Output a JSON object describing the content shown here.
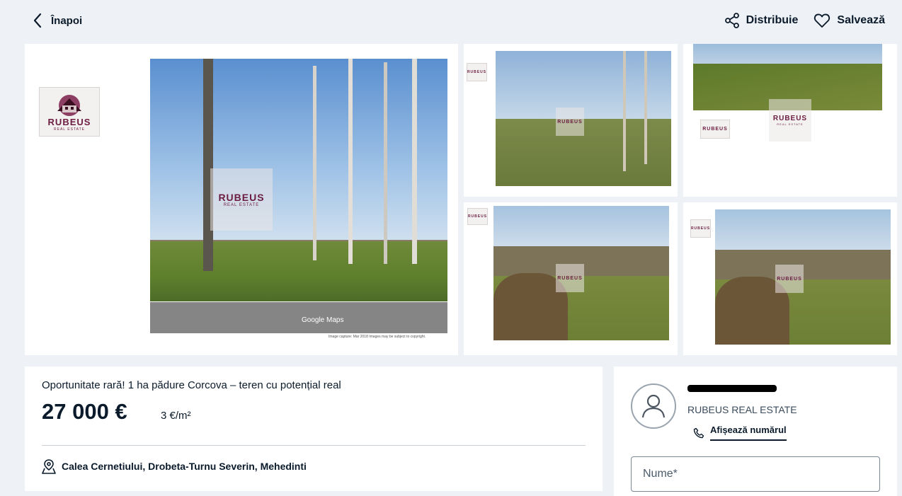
{
  "nav": {
    "back_label": "Înapoi",
    "share_label": "Distribuie",
    "save_label": "Salvează"
  },
  "gallery": {
    "logo_title": "RUBEUS",
    "logo_subtitle": "REAL ESTATE",
    "map_label": "Google Maps",
    "map_caption": "Image capture: Mar 2018    Images may be subject to copyright."
  },
  "listing": {
    "title": "Oportunitate rară! 1 ha pădure Corcova – teren cu potențial real",
    "price": "27 000 €",
    "price_per_sqm": "3 €/m²",
    "address": "Calea Cernetiului, Drobeta-Turnu Severin, Mehedinti"
  },
  "agent": {
    "agency": "RUBEUS REAL ESTATE",
    "show_phone_label": "Afișează numărul",
    "name_placeholder": "Nume*"
  },
  "colors": {
    "brand": "#6b1c40",
    "background": "#eef1f5",
    "text": "#0b1b2b"
  }
}
